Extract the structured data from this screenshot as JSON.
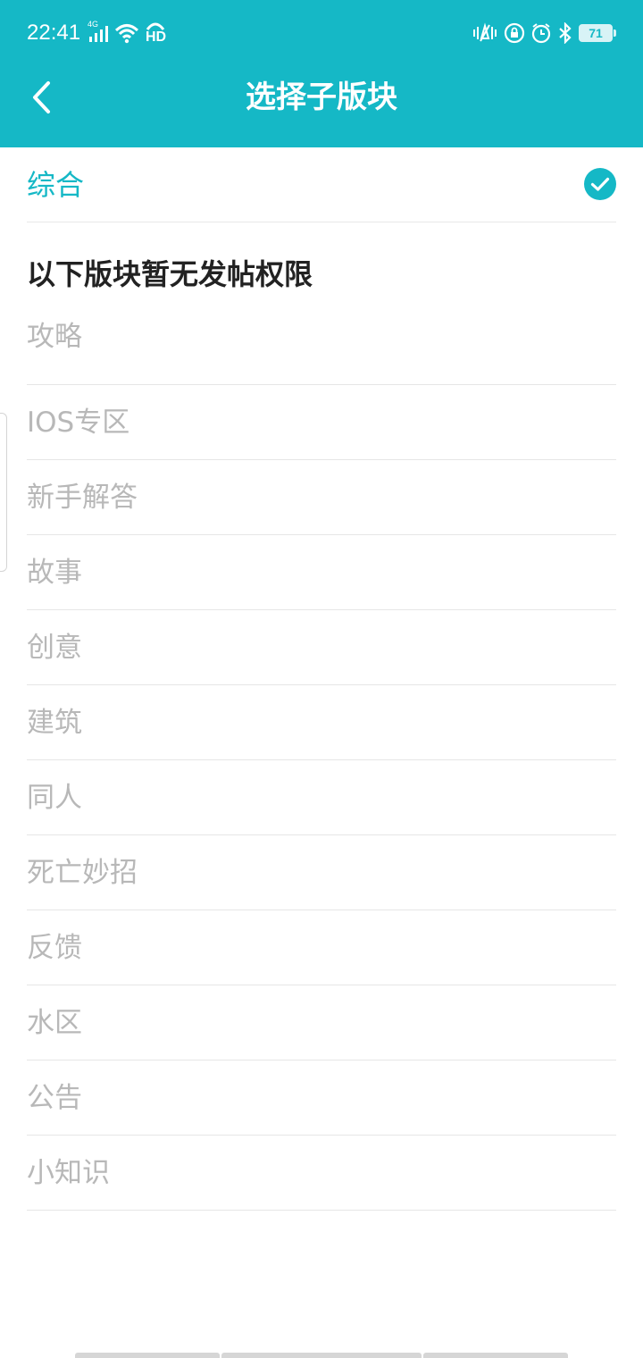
{
  "status_bar": {
    "time": "22:41",
    "network": "4G",
    "hd_label": "HD",
    "battery": "71",
    "left_icons": [
      "signal-4g-icon",
      "wifi-icon",
      "hd-call-icon"
    ],
    "right_icons": [
      "vibrate-icon",
      "rotation-lock-icon",
      "alarm-icon",
      "bluetooth-icon",
      "battery-icon"
    ]
  },
  "header": {
    "title": "选择子版块",
    "back_icon": "chevron-left-icon",
    "background_color": "#15b8c6"
  },
  "selected": {
    "label": "综合",
    "icon": "check-circle-icon",
    "accent_color": "#15b8c6"
  },
  "section": {
    "title": "以下版块暂无发帖权限"
  },
  "disabled_items": [
    {
      "label": "攻略"
    },
    {
      "label": "IOS专区"
    },
    {
      "label": "新手解答"
    },
    {
      "label": "故事"
    },
    {
      "label": "创意"
    },
    {
      "label": "建筑"
    },
    {
      "label": "同人"
    },
    {
      "label": "死亡妙招"
    },
    {
      "label": "反馈"
    },
    {
      "label": "水区"
    },
    {
      "label": "公告"
    },
    {
      "label": "小知识"
    }
  ]
}
